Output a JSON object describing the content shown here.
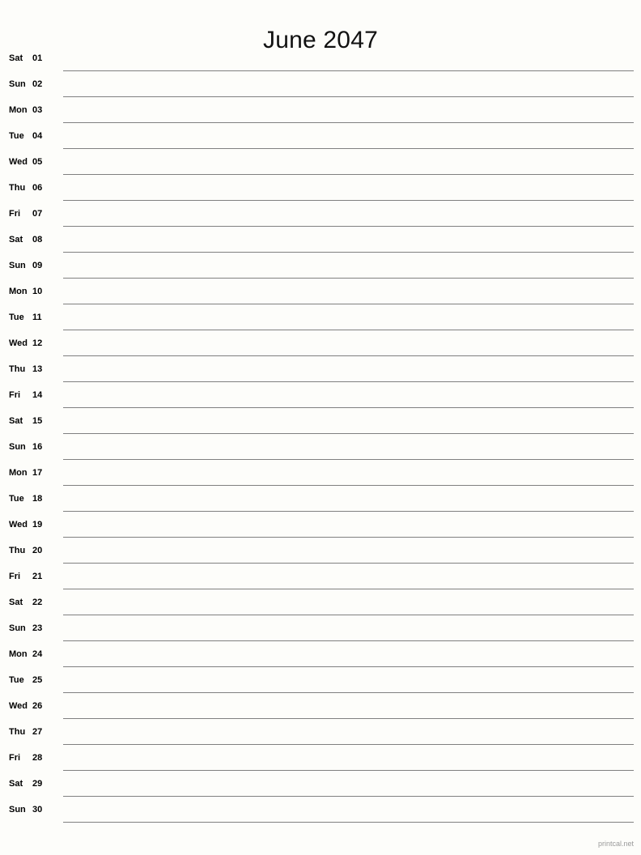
{
  "header": {
    "title": "June 2047"
  },
  "footer": {
    "attribution": "printcal.net"
  },
  "colors": {
    "background": "#fdfdfa",
    "text": "#000000",
    "title_text": "#111111",
    "rule_line": "#808080",
    "footer_text": "#9a9a9a"
  },
  "calendar": {
    "month": "June",
    "year": "2047",
    "day_count": 30,
    "columns": [
      "weekday",
      "day",
      "notes"
    ],
    "days": [
      {
        "weekday": "Sat",
        "day": "01",
        "note": ""
      },
      {
        "weekday": "Sun",
        "day": "02",
        "note": ""
      },
      {
        "weekday": "Mon",
        "day": "03",
        "note": ""
      },
      {
        "weekday": "Tue",
        "day": "04",
        "note": ""
      },
      {
        "weekday": "Wed",
        "day": "05",
        "note": ""
      },
      {
        "weekday": "Thu",
        "day": "06",
        "note": ""
      },
      {
        "weekday": "Fri",
        "day": "07",
        "note": ""
      },
      {
        "weekday": "Sat",
        "day": "08",
        "note": ""
      },
      {
        "weekday": "Sun",
        "day": "09",
        "note": ""
      },
      {
        "weekday": "Mon",
        "day": "10",
        "note": ""
      },
      {
        "weekday": "Tue",
        "day": "11",
        "note": ""
      },
      {
        "weekday": "Wed",
        "day": "12",
        "note": ""
      },
      {
        "weekday": "Thu",
        "day": "13",
        "note": ""
      },
      {
        "weekday": "Fri",
        "day": "14",
        "note": ""
      },
      {
        "weekday": "Sat",
        "day": "15",
        "note": ""
      },
      {
        "weekday": "Sun",
        "day": "16",
        "note": ""
      },
      {
        "weekday": "Mon",
        "day": "17",
        "note": ""
      },
      {
        "weekday": "Tue",
        "day": "18",
        "note": ""
      },
      {
        "weekday": "Wed",
        "day": "19",
        "note": ""
      },
      {
        "weekday": "Thu",
        "day": "20",
        "note": ""
      },
      {
        "weekday": "Fri",
        "day": "21",
        "note": ""
      },
      {
        "weekday": "Sat",
        "day": "22",
        "note": ""
      },
      {
        "weekday": "Sun",
        "day": "23",
        "note": ""
      },
      {
        "weekday": "Mon",
        "day": "24",
        "note": ""
      },
      {
        "weekday": "Tue",
        "day": "25",
        "note": ""
      },
      {
        "weekday": "Wed",
        "day": "26",
        "note": ""
      },
      {
        "weekday": "Thu",
        "day": "27",
        "note": ""
      },
      {
        "weekday": "Fri",
        "day": "28",
        "note": ""
      },
      {
        "weekday": "Sat",
        "day": "29",
        "note": ""
      },
      {
        "weekday": "Sun",
        "day": "30",
        "note": ""
      }
    ]
  }
}
